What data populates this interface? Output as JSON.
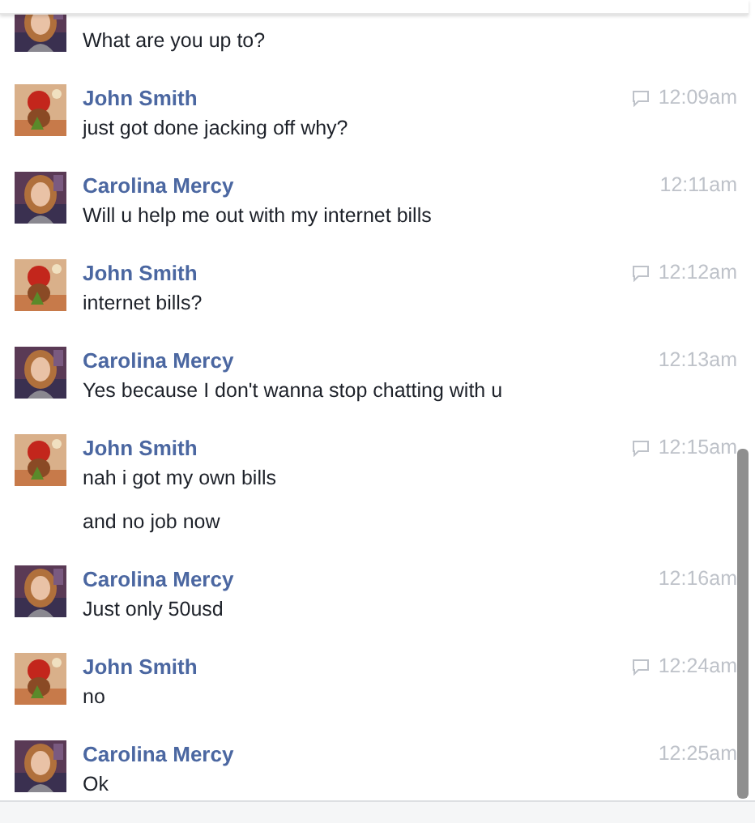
{
  "messages": [
    {
      "kind": "portrait",
      "lines": [
        "What are you up to?"
      ]
    },
    {
      "kind": "toy",
      "sender": "John Smith",
      "time": "12:09am",
      "bubble_icon": true,
      "lines": [
        "just got done jacking off why?"
      ]
    },
    {
      "kind": "portrait",
      "sender": "Carolina Mercy",
      "time": "12:11am",
      "bubble_icon": false,
      "lines": [
        "Will u help me out with my internet bills"
      ]
    },
    {
      "kind": "toy",
      "sender": "John Smith",
      "time": "12:12am",
      "bubble_icon": true,
      "lines": [
        "internet bills?"
      ]
    },
    {
      "kind": "portrait",
      "sender": "Carolina Mercy",
      "time": "12:13am",
      "bubble_icon": false,
      "lines": [
        "Yes because I don't wanna stop chatting with u"
      ]
    },
    {
      "kind": "toy",
      "sender": "John Smith",
      "time": "12:15am",
      "bubble_icon": true,
      "lines": [
        "nah i got my own bills",
        "and no job now"
      ]
    },
    {
      "kind": "portrait",
      "sender": "Carolina Mercy",
      "time": "12:16am",
      "bubble_icon": false,
      "lines": [
        "Just only 50usd"
      ]
    },
    {
      "kind": "toy",
      "sender": "John Smith",
      "time": "12:24am",
      "bubble_icon": true,
      "lines": [
        "no"
      ]
    },
    {
      "kind": "portrait",
      "sender": "Carolina Mercy",
      "time": "12:25am",
      "bubble_icon": false,
      "lines": [
        "Ok"
      ]
    }
  ]
}
